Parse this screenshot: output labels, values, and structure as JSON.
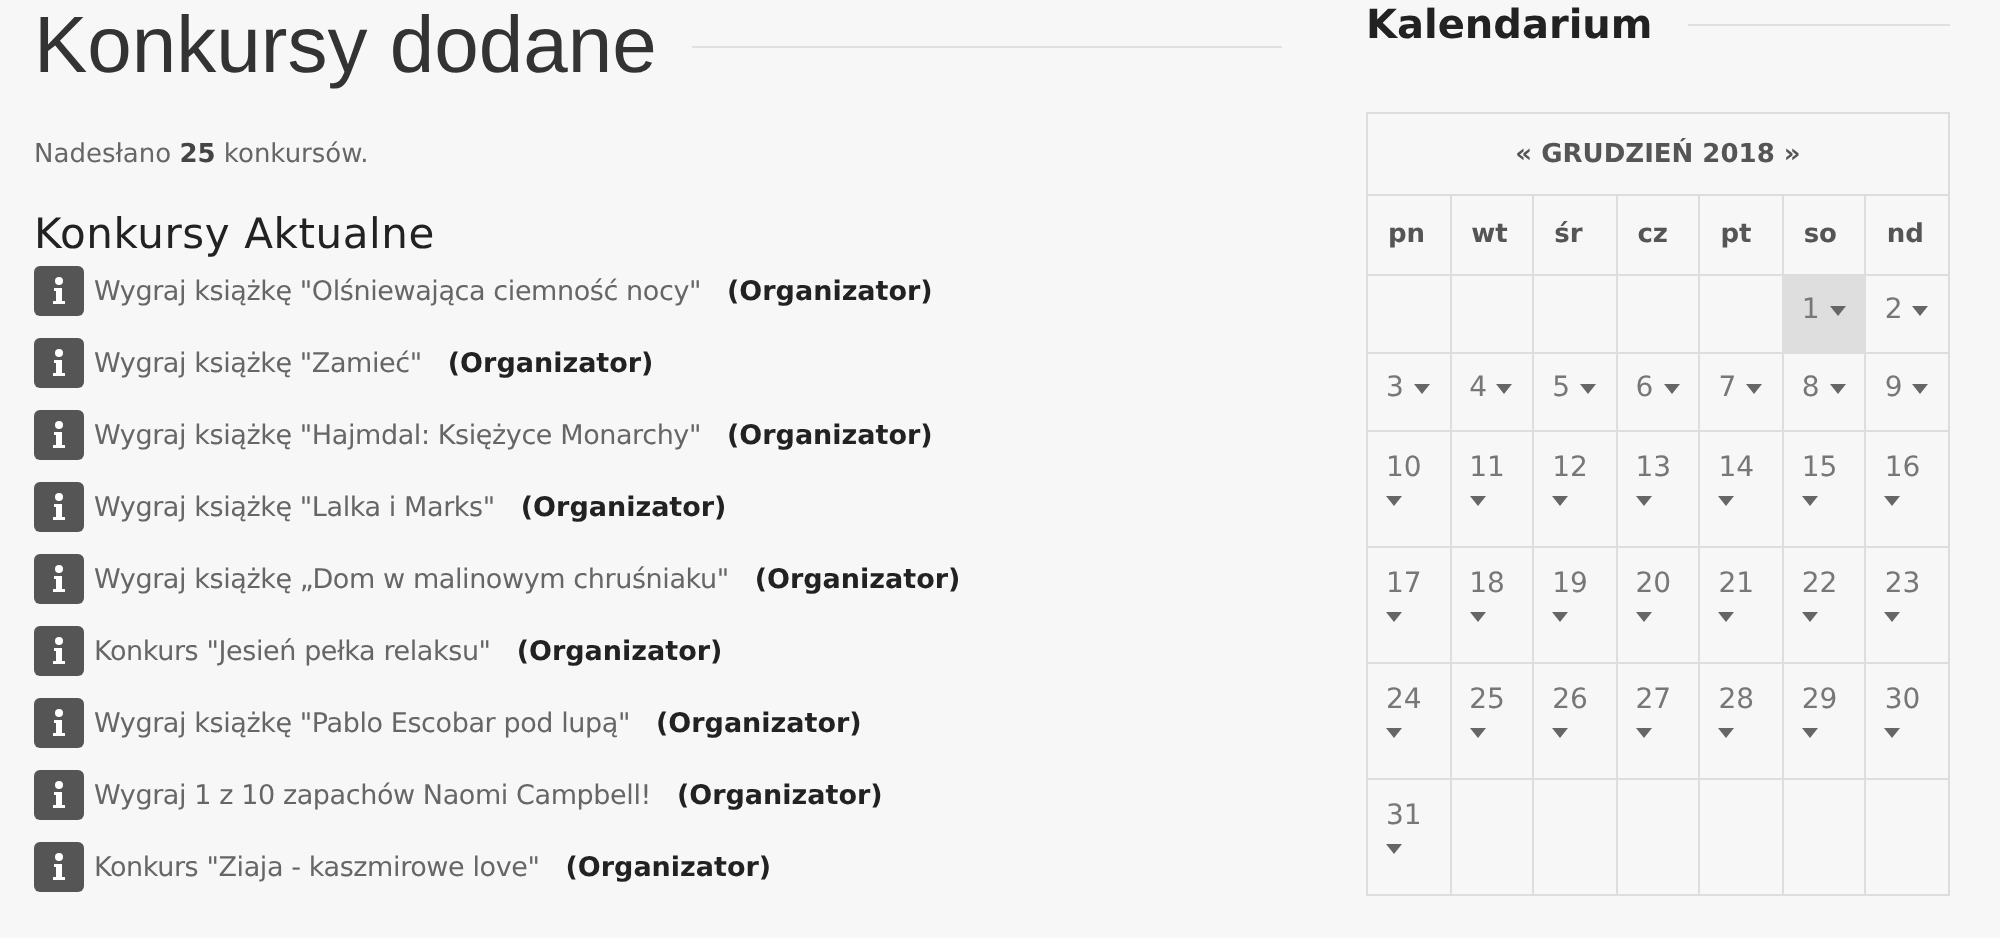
{
  "page_title": "Konkursy dodane",
  "summary": "Nadesłano **25** konkursów.",
  "section_title": "Konkursy Aktualne",
  "contests": [
    {
      "title": "Wygraj książkę \"Olśniewająca ciemność nocy\"",
      "author": "(Organizator)"
    },
    {
      "title": "Wygraj książkę \"Zamieć\"",
      "author": "(Organizator)"
    },
    {
      "title": "Wygraj książkę \"Hajmdal: Księżyce Monarchy\"",
      "author": "(Organizator)"
    },
    {
      "title": "Wygraj książkę \"Lalka i Marks\"",
      "author": "(Organizator)"
    },
    {
      "title": "Wygraj książkę „Dom w malinowym chruśniaku\"",
      "author": "(Organizator)"
    },
    {
      "title": "Konkurs \"Jesień pełka relaksu\"",
      "author": "(Organizator)"
    },
    {
      "title": "Wygraj książkę \"Pablo Escobar pod lupą\"",
      "author": "(Organizator)"
    },
    {
      "title": "Wygraj 1 z 10 zapachów Naomi Campbell!",
      "author": "(Organizator)"
    },
    {
      "title": "Konkurs \"Ziaja - kaszmirowe love\"",
      "author": "(Organizator)"
    }
  ],
  "calendar": {
    "title": "Kalendarium",
    "prev": "«",
    "month": "GRUDZIEŃ 2018",
    "next": "»",
    "weekdays": [
      "pn",
      "wt",
      "śr",
      "cz",
      "pt",
      "so",
      "nd"
    ],
    "weeks": [
      [
        {
          "kind": "blank"
        },
        {
          "kind": "blank"
        },
        {
          "kind": "blank"
        },
        {
          "kind": "blank"
        },
        {
          "kind": "blank"
        },
        {
          "kind": "day",
          "day": "1",
          "selected": true
        },
        {
          "kind": "day",
          "day": "2",
          "selected": false
        }
      ],
      [
        {
          "kind": "day",
          "day": "3",
          "selected": false
        },
        {
          "kind": "day",
          "day": "4",
          "selected": false
        },
        {
          "kind": "day",
          "day": "5",
          "selected": false
        },
        {
          "kind": "day",
          "day": "6",
          "selected": false
        },
        {
          "kind": "day",
          "day": "7",
          "selected": false
        },
        {
          "kind": "day",
          "day": "8",
          "selected": false
        },
        {
          "kind": "day",
          "day": "9",
          "selected": false
        }
      ],
      [
        {
          "kind": "day",
          "day": "10",
          "selected": false
        },
        {
          "kind": "day",
          "day": "11",
          "selected": false
        },
        {
          "kind": "day",
          "day": "12",
          "selected": false
        },
        {
          "kind": "day",
          "day": "13",
          "selected": false
        },
        {
          "kind": "day",
          "day": "14",
          "selected": false
        },
        {
          "kind": "day",
          "day": "15",
          "selected": false
        },
        {
          "kind": "day",
          "day": "16",
          "selected": false
        }
      ],
      [
        {
          "kind": "day",
          "day": "17",
          "selected": false
        },
        {
          "kind": "day",
          "day": "18",
          "selected": false
        },
        {
          "kind": "day",
          "day": "19",
          "selected": false
        },
        {
          "kind": "day",
          "day": "20",
          "selected": false
        },
        {
          "kind": "day",
          "day": "21",
          "selected": false
        },
        {
          "kind": "day",
          "day": "22",
          "selected": false
        },
        {
          "kind": "day",
          "day": "23",
          "selected": false
        }
      ],
      [
        {
          "kind": "day",
          "day": "24",
          "selected": false
        },
        {
          "kind": "day",
          "day": "25",
          "selected": false
        },
        {
          "kind": "day",
          "day": "26",
          "selected": false
        },
        {
          "kind": "day",
          "day": "27",
          "selected": false
        },
        {
          "kind": "day",
          "day": "28",
          "selected": false
        },
        {
          "kind": "day",
          "day": "29",
          "selected": false
        },
        {
          "kind": "day",
          "day": "30",
          "selected": false
        }
      ],
      [
        {
          "kind": "day",
          "day": "31",
          "selected": false
        },
        {
          "kind": "blank"
        },
        {
          "kind": "blank"
        },
        {
          "kind": "blank"
        },
        {
          "kind": "blank"
        },
        {
          "kind": "blank"
        },
        {
          "kind": "blank"
        }
      ]
    ]
  }
}
